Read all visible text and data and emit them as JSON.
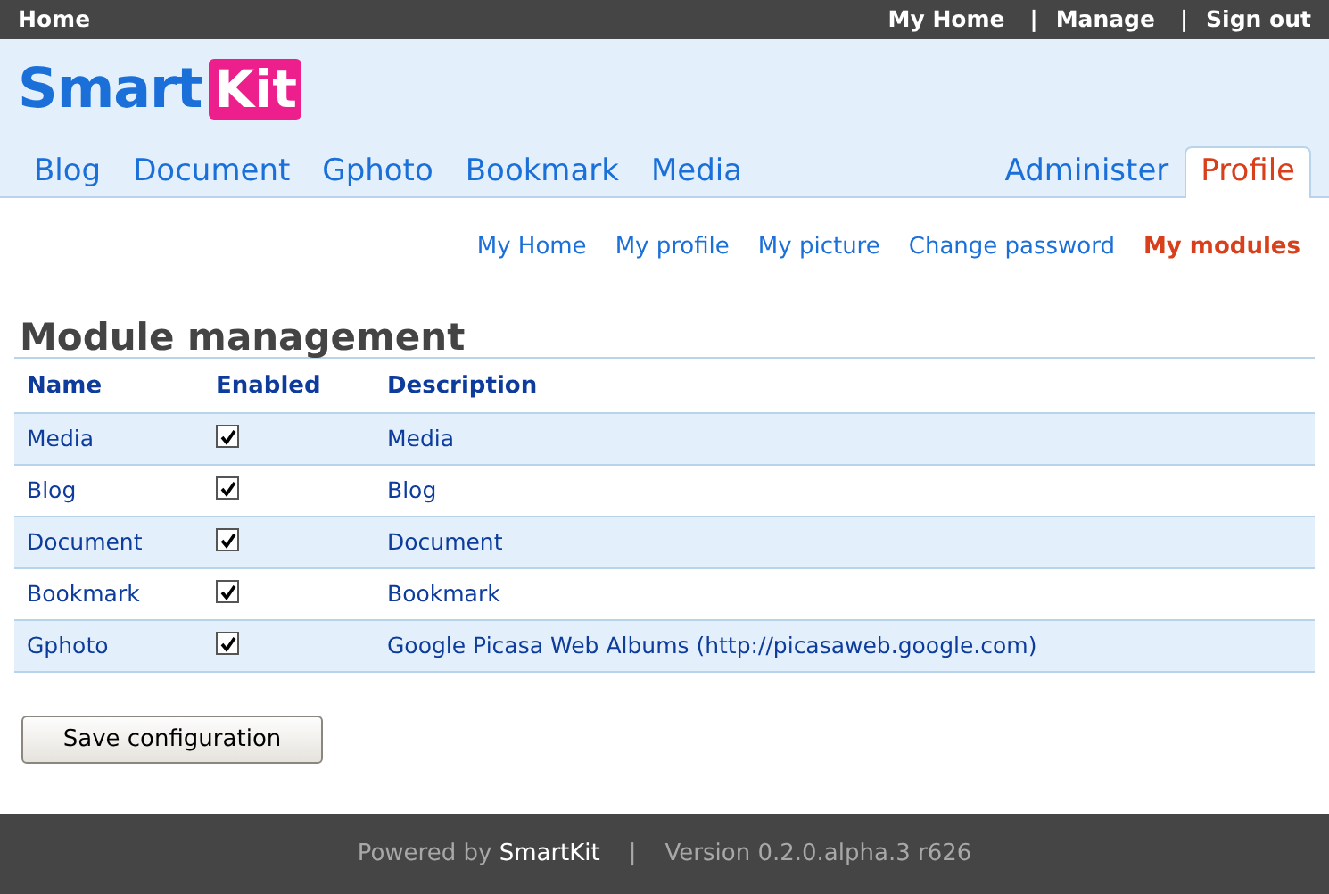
{
  "top_bar": {
    "left": "Home",
    "right": [
      {
        "label": "My Home"
      },
      {
        "separator": "|",
        "label": "Manage"
      },
      {
        "separator": "|",
        "label": "Sign out"
      }
    ]
  },
  "logo": {
    "part_1": "Smart",
    "part_2": "Kit"
  },
  "module_tabs": [
    {
      "label": "Blog",
      "selected": false
    },
    {
      "label": "Document",
      "selected": false
    },
    {
      "label": "Gphoto",
      "selected": false
    },
    {
      "label": "Bookmark",
      "selected": false
    },
    {
      "label": "Media",
      "selected": false
    }
  ],
  "account_tabs": [
    {
      "label": "Administer",
      "selected": false
    },
    {
      "label": "Profile",
      "selected": true
    }
  ],
  "sub_nav": [
    {
      "label": "My Home",
      "selected": false
    },
    {
      "label": "My profile",
      "selected": false
    },
    {
      "label": "My picture",
      "selected": false
    },
    {
      "label": "Change password",
      "selected": false
    },
    {
      "label": "My modules",
      "selected": true
    }
  ],
  "heading": "Module management",
  "table": {
    "columns": [
      "Name",
      "Enabled",
      "Description"
    ],
    "rows": [
      {
        "name": "Media",
        "enabled": true,
        "description": "Media"
      },
      {
        "name": "Blog",
        "enabled": true,
        "description": "Blog"
      },
      {
        "name": "Document",
        "enabled": true,
        "description": "Document"
      },
      {
        "name": "Bookmark",
        "enabled": true,
        "description": "Bookmark"
      },
      {
        "name": "Gphoto",
        "enabled": true,
        "description": "Google Picasa Web Albums (http://picasaweb.google.com)"
      }
    ]
  },
  "save_button": "Save configuration",
  "footer": {
    "powered_by": "Powered by",
    "brand": "SmartKit",
    "separator": "|",
    "version": "Version 0.2.0.alpha.3 r626"
  }
}
